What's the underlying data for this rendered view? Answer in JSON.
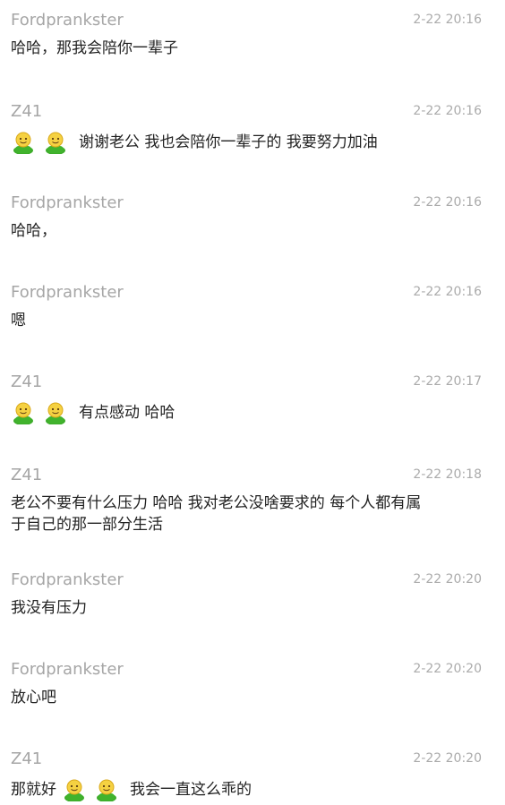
{
  "messages": [
    {
      "sender": "Fordprankster",
      "time": "2-22 20:16",
      "text": "哈哈，那我会陪你一辈子"
    },
    {
      "sender": "Z41",
      "time": "2-22 20:16",
      "emoji": [
        "smiley-person",
        "smiley-person"
      ],
      "text": "谢谢老公 我也会陪你一辈子的 我要努力加油"
    },
    {
      "sender": "Fordprankster",
      "time": "2-22 20:16",
      "text": "哈哈，"
    },
    {
      "sender": "Fordprankster",
      "time": "2-22 20:16",
      "text": "嗯"
    },
    {
      "sender": "Z41",
      "time": "2-22 20:17",
      "emoji": [
        "smiley-person",
        "smiley-person"
      ],
      "text": "有点感动 哈哈"
    },
    {
      "sender": "Z41",
      "time": "2-22 20:18",
      "text_line1": "老公不要有什么压力 哈哈 我对老公没啥要求的 每个人都有属",
      "text_line2": "于自己的那一部分生活"
    },
    {
      "sender": "Fordprankster",
      "time": "2-22 20:20",
      "text": "我没有压力"
    },
    {
      "sender": "Fordprankster",
      "time": "2-22 20:20",
      "text": "放心吧"
    },
    {
      "sender": "Z41",
      "time": "2-22 20:20",
      "text_pre": "那就好",
      "emoji": [
        "smiley-person",
        "smiley-person"
      ],
      "text": "我会一直这么乖的"
    }
  ]
}
